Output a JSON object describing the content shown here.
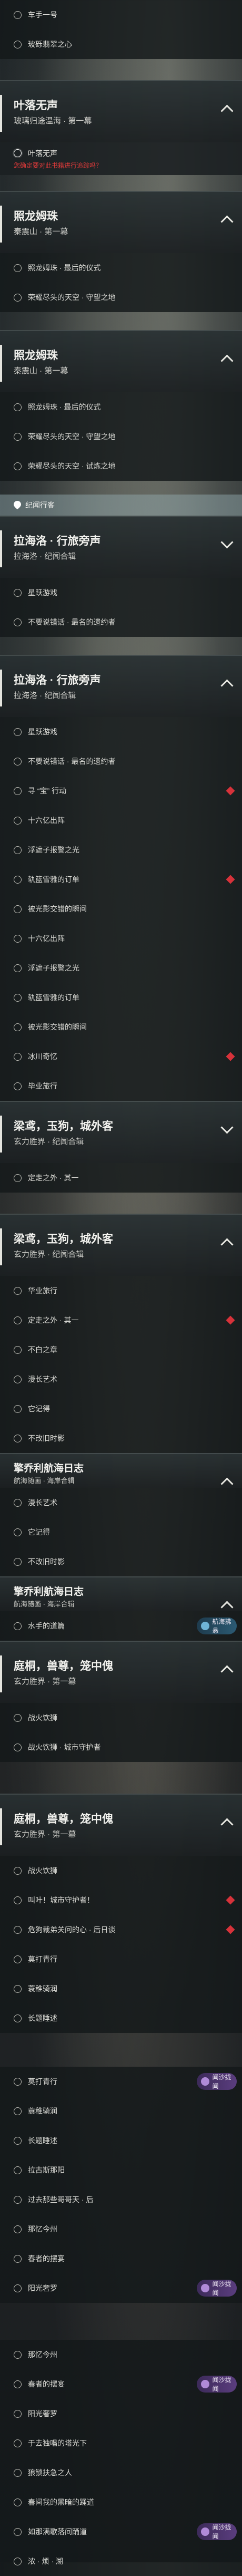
{
  "tracking_label": "纪闻行客",
  "warning_text": "您确定要对此书籍进行追踪吗？",
  "badge_text": "闻沙拢闻",
  "badge_text_blue": "航海拂悬",
  "sections": [
    {
      "title": "叶落无声",
      "subtitle": "玻璃归途温海 · 第一幕"
    },
    {
      "title": "照龙姆珠",
      "subtitle": "秦震山 · 第一幕"
    },
    {
      "title": "照龙姆珠",
      "subtitle": "秦震山 · 第一幕"
    },
    {
      "title": "拉海洛 · 行旅旁声",
      "subtitle": "拉海洛 · 纪闻合辑"
    },
    {
      "title": "拉海洛 · 行旅旁声",
      "subtitle": "拉海洛 · 纪闻合辑"
    },
    {
      "title": "梁鸢，玉狗，城外客",
      "subtitle": "玄力胜界 · 纪闻合辑"
    },
    {
      "title": "梁鸢，玉狗，城外客",
      "subtitle": "玄力胜界 · 纪闻合辑"
    },
    {
      "title": "擎乔利航海日志",
      "subtitle": "航海随画 · 海岸合辑"
    },
    {
      "title": "庭桐，兽尊，笼中傀",
      "subtitle": "玄力胜界 · 第一幕"
    },
    {
      "title": "庭桐，兽尊，笼中傀",
      "subtitle": "玄力胜界 · 第一幕"
    }
  ],
  "items": {
    "top": [
      "车手一号",
      "玻砾翡翠之心"
    ],
    "s0": [
      "叶落无声"
    ],
    "s1": [
      "照龙姆珠 · 最后的仪式",
      "荣耀尽头的天空 · 守望之地"
    ],
    "s2": [
      "照龙姆珠 · 最后的仪式",
      "荣耀尽头的天空 · 守望之地",
      "荣耀尽头的天空 · 试炼之地"
    ],
    "s3": [
      "星跃游戏",
      "不要说错话 · 最名的遗约者"
    ],
    "s4": [
      "星跃游戏",
      "不要说错话 · 最名的遗约者",
      "寻 “宝” 行动",
      "十六亿出阵",
      "浮遮子报警之光",
      "轨篮雪雅的订单",
      "被光影交错的瞬间",
      "十六亿出阵",
      "浮遮子报警之光",
      "轨篮雪雅的订单",
      "被光影交错的瞬间",
      "冰川奇忆",
      "毕业旅行"
    ],
    "s5": [
      "定走之外 · 其一"
    ],
    "s6": [
      "华业旅行",
      "定走之外 · 其一",
      "不白之章",
      "漫长艺术",
      "它记得",
      "不改旧时影"
    ],
    "s6b": [
      "漫长艺术",
      "它记得",
      "不改旧时影"
    ],
    "s7": [
      "水手的道篇"
    ],
    "s8": [
      "战火饮狮",
      "战火饮狮 · 城市守护者"
    ],
    "s9": [
      "战火饮狮",
      "叫叶！城市守护者！",
      "危狗裁弟关问的心 · 后日谈",
      "莫打青行",
      "蓑稚骑润",
      "长题睡述"
    ],
    "tail": [
      "莫打青行",
      "蓑稚骑润",
      "长题睡述",
      "拉古斯那阳",
      "过去那些哥哥天 · 后",
      "那忆今州",
      "春者的摆宴",
      "阳光奢罗"
    ],
    "tail2": [
      "那忆今州",
      "春者的摆宴",
      "阳光奢罗",
      "于去独唱的塔光下",
      "狼锁扶急之人",
      "春间我的黑暗的踊道",
      "如那满歌落间踊道",
      "浓 · 烦 · 湖"
    ]
  }
}
